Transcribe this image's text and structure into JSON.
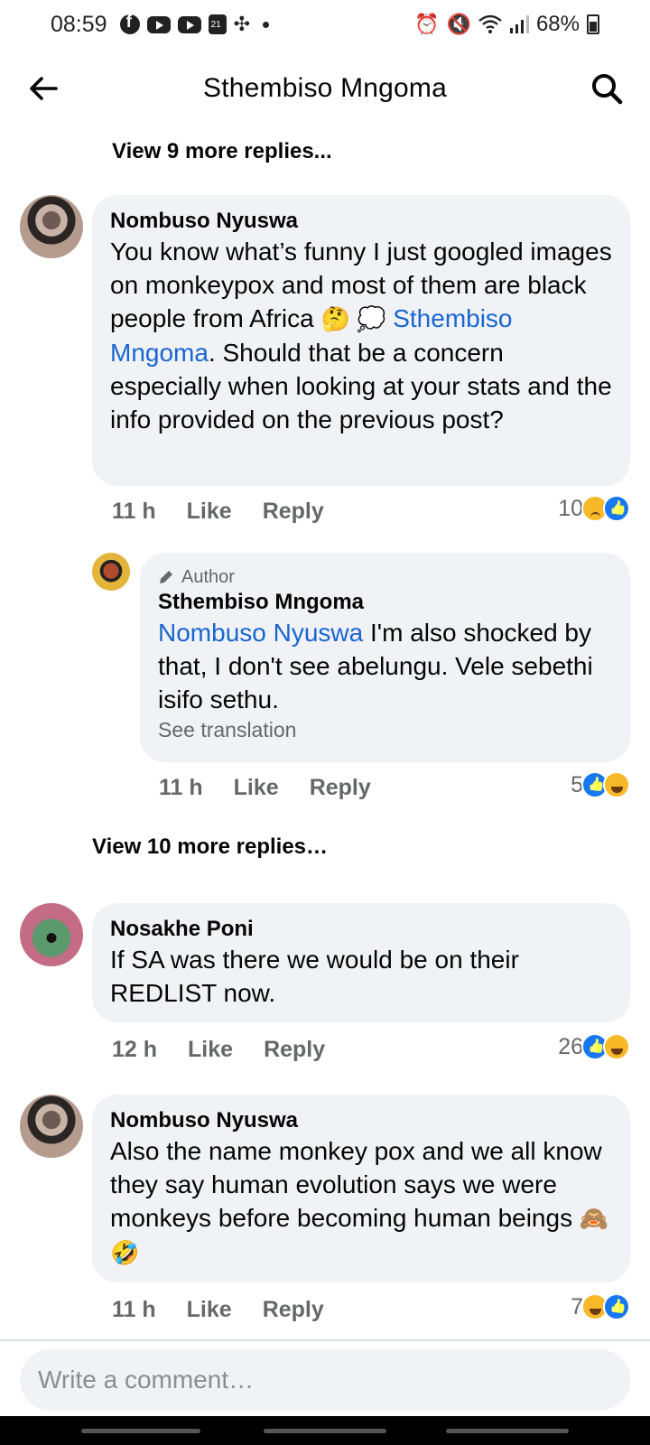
{
  "status_bar": {
    "time": "08:59",
    "battery": "68%"
  },
  "header": {
    "title": "Sthembiso Mngoma"
  },
  "thread": {
    "view_more_top": "View 9 more replies...",
    "view_more_middle": "View 10 more replies…"
  },
  "comments": [
    {
      "author": "Nombuso Nyuswa",
      "text_before_mention": "You know what’s funny I just googled images on monkeypox and most of them are black people from Africa",
      "emojis": "🤔 💭",
      "mention": "Sthembiso Mngoma",
      "text_after_mention": ". Should that be a concern especially when looking at your stats and the info provided on the previous post?",
      "time": "11 h",
      "like_label": "Like",
      "reply_label": "Reply",
      "reaction_count": "10",
      "reaction_icons": [
        "sad-reaction-icon",
        "like-reaction-icon"
      ]
    },
    {
      "badge": "Author",
      "author": "Sthembiso Mngoma",
      "mention": "Nombuso Nyuswa",
      "text_after_mention": " I'm also shocked by that, I don't see abelungu. Vele sebethi isifo sethu.",
      "see_translation": "See translation",
      "time": "11 h",
      "like_label": "Like",
      "reply_label": "Reply",
      "reaction_count": "5",
      "reaction_icons": [
        "like-reaction-icon",
        "haha-reaction-icon"
      ]
    },
    {
      "author": "Nosakhe Poni",
      "text": "If SA was there we would be on their REDLIST now.",
      "time": "12 h",
      "like_label": "Like",
      "reply_label": "Reply",
      "reaction_count": "26",
      "reaction_icons": [
        "like-reaction-icon",
        "haha-reaction-icon"
      ]
    },
    {
      "author": "Nombuso Nyuswa",
      "text": "Also the name monkey pox and we all know they say human evolution says we were monkeys before becoming human beings",
      "emojis": "🙈🤣",
      "time": "11 h",
      "like_label": "Like",
      "reply_label": "Reply",
      "reaction_count": "7",
      "reaction_icons": [
        "haha-reaction-icon",
        "like-reaction-icon"
      ]
    }
  ],
  "composer": {
    "placeholder": "Write a comment…"
  },
  "colors": {
    "mention_link": "#1866d0",
    "bubble_bg": "#f0f2f5",
    "meta_text": "#65676b",
    "like_blue": "#1877f2",
    "reaction_yellow": "#f7b928"
  }
}
